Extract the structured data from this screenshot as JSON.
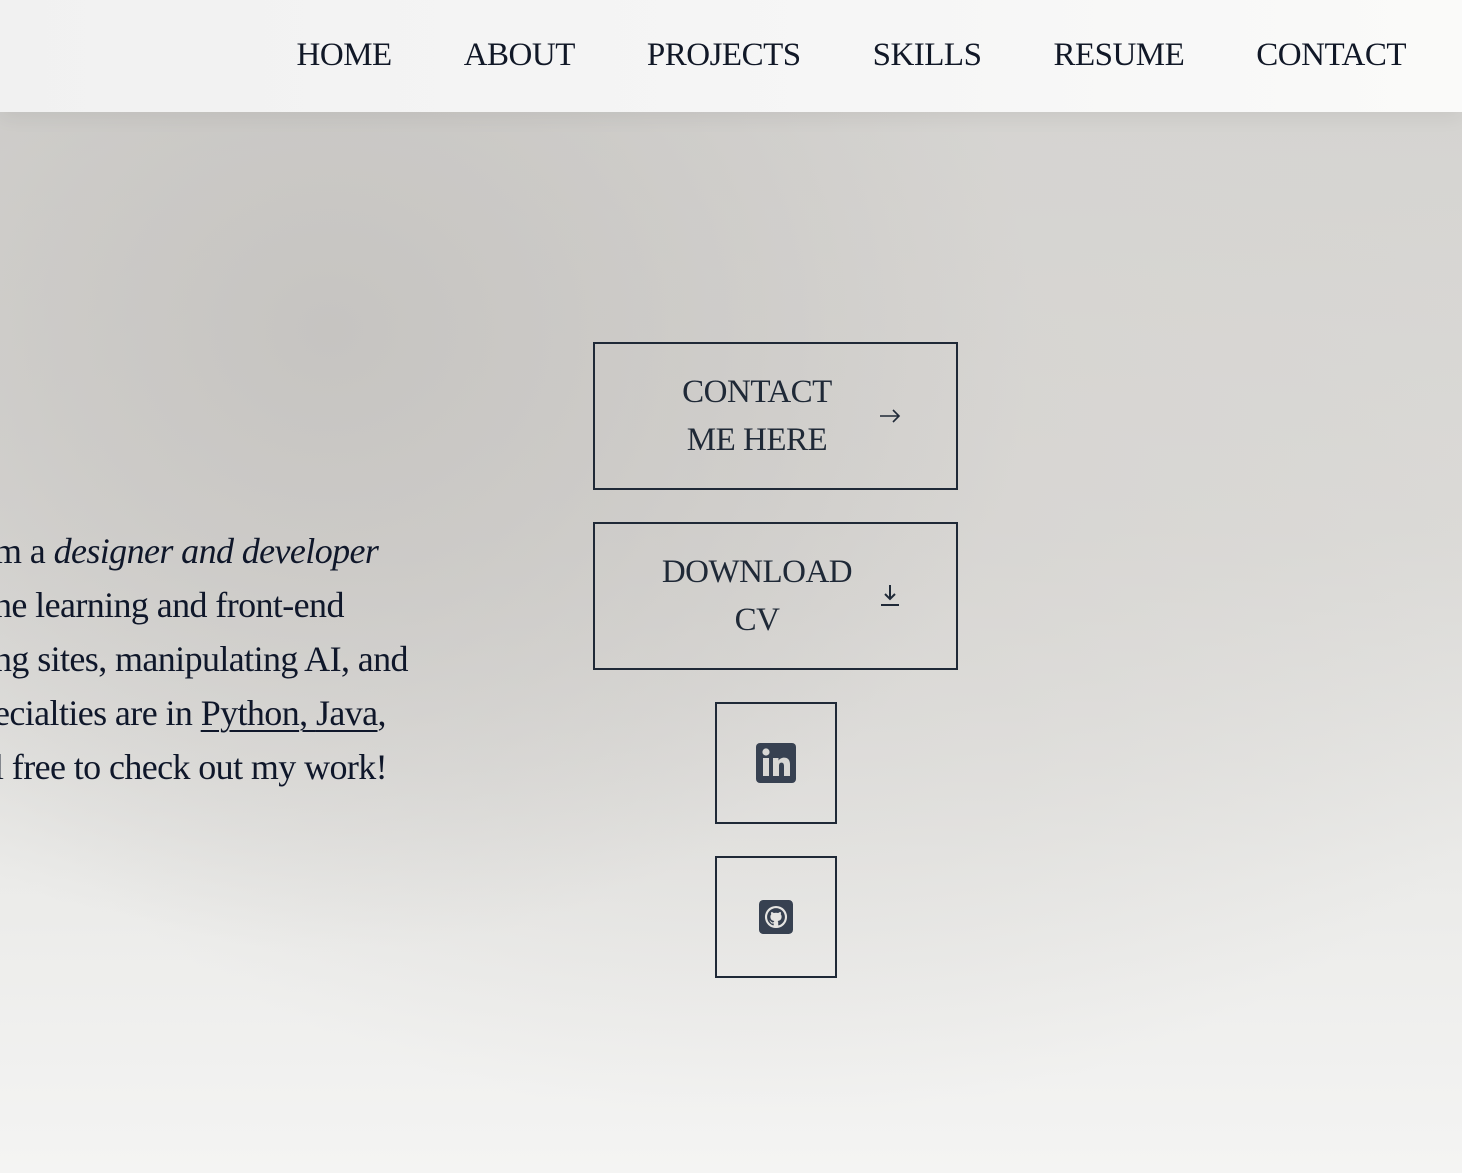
{
  "nav": {
    "items": [
      {
        "label": "HOME"
      },
      {
        "label": "ABOUT"
      },
      {
        "label": "PROJECTS"
      },
      {
        "label": "SKILLS"
      },
      {
        "label": "RESUME"
      },
      {
        "label": "CONTACT"
      }
    ]
  },
  "bio": {
    "line1_prefix": "m a ",
    "line1_emphasis": "designer and developer",
    "line2": "ne learning and front-end",
    "line3": "ng sites, manipulating AI, and",
    "line4_prefix": "ecialties are in ",
    "link_python": "Python",
    "link_separator": ", ",
    "link_java": "Java",
    "line4_suffix": ",",
    "line5": "l free to check out my work!"
  },
  "buttons": {
    "contact_line1": "CONTACT",
    "contact_line2": "ME HERE",
    "contact_icon": "arrow-right-icon",
    "cv_line1": "DOWNLOAD",
    "cv_line2": "CV",
    "cv_icon": "download-icon",
    "linkedin_icon": "linkedin-icon",
    "github_icon": "github-icon"
  },
  "colors": {
    "text": "#111827",
    "border": "#1f2937",
    "icon": "#374151"
  }
}
